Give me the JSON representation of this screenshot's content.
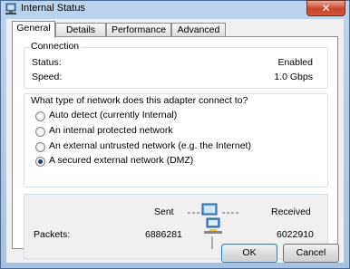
{
  "window": {
    "title": "Internal Status"
  },
  "tabs": [
    "General",
    "Details",
    "Performance",
    "Advanced"
  ],
  "connection": {
    "group_title": "Connection",
    "rows": [
      {
        "label": "Status:",
        "value": "Enabled"
      },
      {
        "label": "Speed:",
        "value": "1.0 Gbps"
      }
    ]
  },
  "network_type": {
    "question": "What type of network does this adapter connect to?",
    "options": [
      "Auto detect (currently Internal)",
      "An internal protected network",
      "An external untrusted network (e.g. the Internet)",
      "A secured external network (DMZ)"
    ],
    "selected_index": 3
  },
  "activity": {
    "sent_label": "Sent",
    "received_label": "Received",
    "packets_label": "Packets:",
    "packets_sent": "6886281",
    "packets_received": "6022910"
  },
  "buttons": {
    "ok": "OK",
    "cancel": "Cancel"
  },
  "icons": {
    "window_icon": "network-adapter-icon",
    "close": "close-icon",
    "activity": "network-activity-icon"
  },
  "colors": {
    "title_bar": "#bcd3ec",
    "close_button": "#c9462c",
    "selected_radio": "#1f3f7a"
  }
}
